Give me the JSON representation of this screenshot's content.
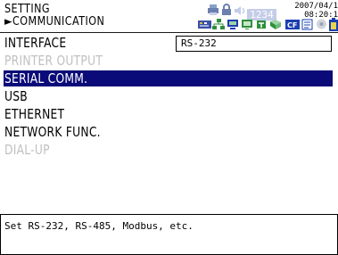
{
  "header": {
    "title": "SETTING",
    "subtitle": "►COMMUNICATION",
    "counter": "1234",
    "date": "2007/04/1",
    "time": "08:20:1"
  },
  "menu": {
    "value": "RS-232",
    "items": [
      {
        "label": "INTERFACE",
        "state": "normal"
      },
      {
        "label": "PRINTER OUTPUT",
        "state": "disabled"
      },
      {
        "label": "SERIAL COMM.",
        "state": "selected"
      },
      {
        "label": "USB",
        "state": "normal"
      },
      {
        "label": "ETHERNET",
        "state": "normal"
      },
      {
        "label": "NETWORK FUNC.",
        "state": "normal"
      },
      {
        "label": "DIAL-UP",
        "state": "disabled"
      }
    ]
  },
  "help": {
    "text": "Set RS-232, RS-485, Modbus, etc."
  },
  "icons": [
    "printer-icon",
    "lock-icon",
    "sound-icon",
    "counter-icon",
    "keyboard-icon",
    "network-icon",
    "computer-icon",
    "monitor-icon",
    "usb-icon",
    "cf-card-icon",
    "document-icon",
    "disk-icon",
    "battery-icon"
  ],
  "colors": {
    "selection": "#0a0a78",
    "disabled_text": "#c0c0c0",
    "icon_green": "#2f8f3a",
    "icon_blue": "#1a3fb0"
  }
}
